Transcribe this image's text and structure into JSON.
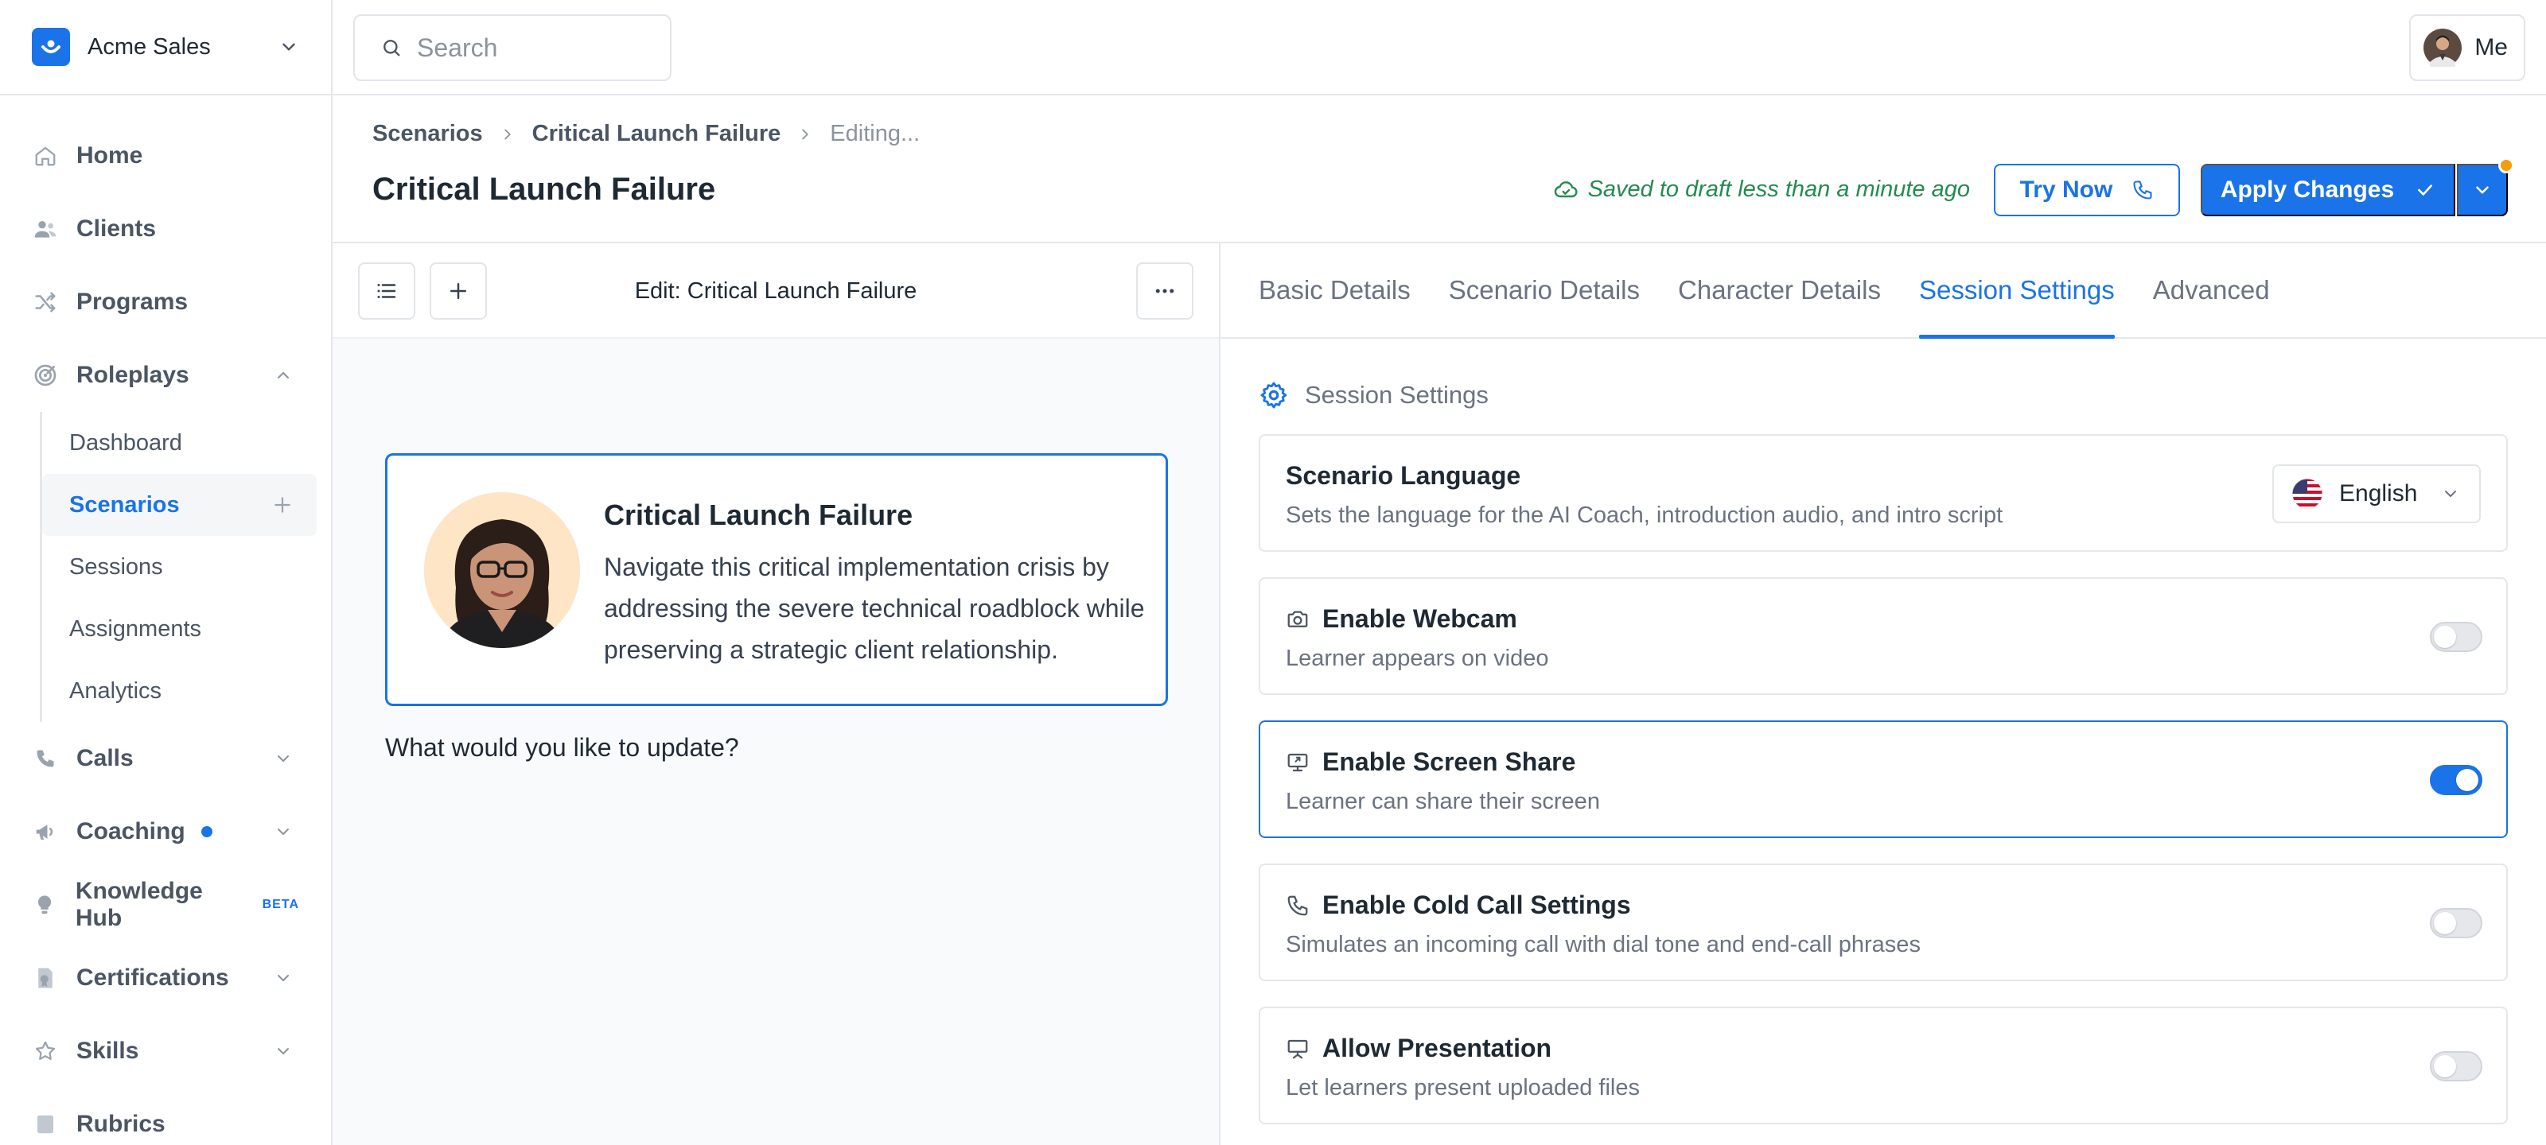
{
  "org": {
    "name": "Acme Sales"
  },
  "nav": {
    "home": "Home",
    "clients": "Clients",
    "programs": "Programs",
    "roleplays": "Roleplays",
    "roleplays_sub": {
      "dashboard": "Dashboard",
      "scenarios": "Scenarios",
      "sessions": "Sessions",
      "assignments": "Assignments",
      "analytics": "Analytics"
    },
    "calls": "Calls",
    "coaching": "Coaching",
    "knowledge_hub": "Knowledge Hub",
    "knowledge_hub_badge": "BETA",
    "certifications": "Certifications",
    "skills": "Skills",
    "rubrics": "Rubrics"
  },
  "topbar": {
    "search_placeholder": "Search",
    "user_label": "Me"
  },
  "breadcrumb": {
    "root": "Scenarios",
    "item": "Critical Launch Failure",
    "current": "Editing..."
  },
  "page": {
    "title": "Critical Launch Failure",
    "saved_status": "Saved to draft less than a minute ago",
    "try_now": "Try Now",
    "apply_changes": "Apply Changes"
  },
  "editor": {
    "title": "Edit: Critical Launch Failure",
    "card_title": "Critical Launch Failure",
    "card_description": "Navigate this critical implementation crisis by addressing the severe technical roadblock while preserving a strategic client relationship.",
    "prompt": "What would you like to update?"
  },
  "tabs": [
    "Basic Details",
    "Scenario Details",
    "Character Details",
    "Session Settings",
    "Advanced"
  ],
  "active_tab": "Session Settings",
  "settings": {
    "section_title": "Session Settings",
    "language": {
      "title": "Scenario Language",
      "description": "Sets the language for the AI Coach, introduction audio, and intro script",
      "value": "English"
    },
    "webcam": {
      "title": "Enable Webcam",
      "description": "Learner appears on video",
      "enabled": false
    },
    "screen_share": {
      "title": "Enable Screen Share",
      "description": "Learner can share their screen",
      "enabled": true
    },
    "cold_call": {
      "title": "Enable Cold Call Settings",
      "description": "Simulates an incoming call with dial tone and end-call phrases",
      "enabled": false
    },
    "presentation": {
      "title": "Allow Presentation",
      "description": "Let learners present uploaded files",
      "enabled": false
    }
  },
  "colors": {
    "accent": "#1a73e8",
    "success": "#228b4f",
    "notification": "#f59e0b"
  }
}
